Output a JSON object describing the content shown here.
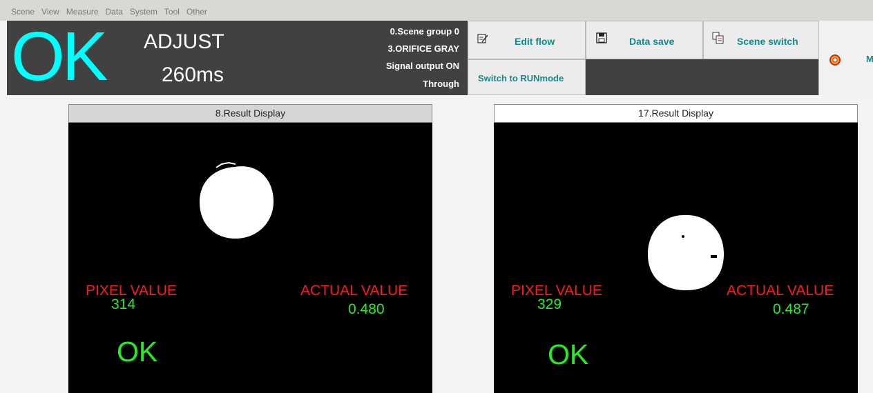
{
  "menu": [
    "Scene",
    "View",
    "Measure",
    "Data",
    "System",
    "Tool",
    "Other"
  ],
  "status": {
    "judgement": "OK",
    "mode": "ADJUST",
    "time": "260ms",
    "scene_group": "0.Scene group 0",
    "scene": "3.ORIFICE GRAY",
    "signal_output": "Signal output ON",
    "through": "Through"
  },
  "toolbar": {
    "edit_flow": "Edit flow",
    "data_save": "Data save",
    "scene_switch": "Scene switch",
    "switch_run": "Switch to RUNmode",
    "truncated": "M"
  },
  "panels": [
    {
      "title": "8.Result Display",
      "pixel_label": "PIXEL VALUE",
      "pixel_value": "314",
      "actual_label": "ACTUAL VALUE",
      "actual_value": "0.480",
      "judgement": "OK"
    },
    {
      "title": "17.Result Display",
      "pixel_label": "PIXEL VALUE",
      "pixel_value": "329",
      "actual_label": "ACTUAL VALUE",
      "actual_value": "0.487",
      "judgement": "OK"
    }
  ],
  "colors": {
    "ok_cyan": "#00ffff",
    "label_red": "#ff1a1a",
    "value_green": "#22ee22",
    "status_bg": "#414141",
    "button_text": "#138a8a"
  },
  "icons": [
    "edit-icon",
    "floppy-disk-icon",
    "scene-switch-icon",
    "gear-target-icon"
  ]
}
